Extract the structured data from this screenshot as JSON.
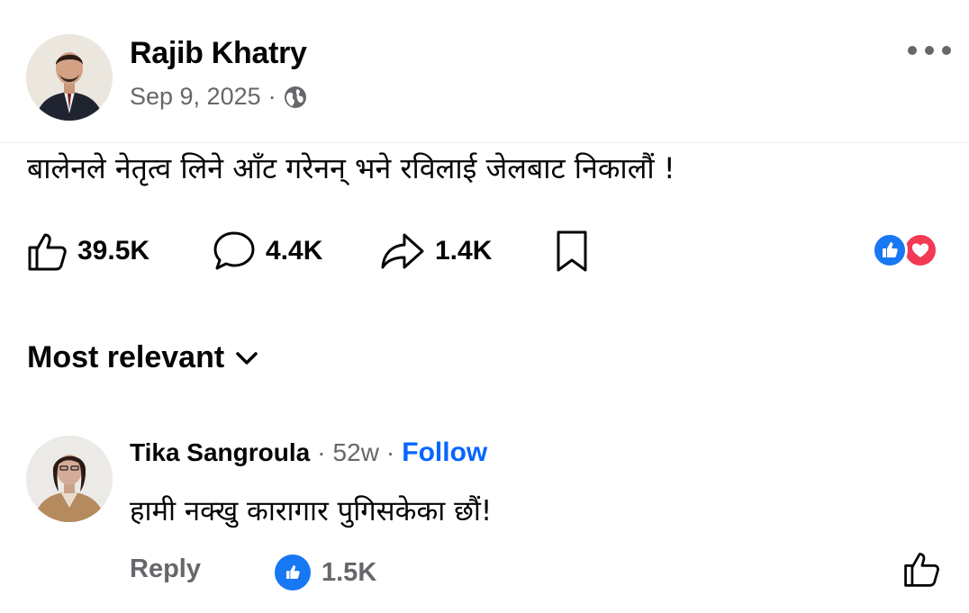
{
  "post": {
    "author": "Rajib Khatry",
    "date": "Sep 9, 2025",
    "separator": "·",
    "audience_icon": "globe-icon",
    "text": "बालेनले नेतृत्व लिने आँट गरेनन् भने रविलाई जेलबाट निकालौं !"
  },
  "actions": {
    "likes": "39.5K",
    "comments": "4.4K",
    "shares": "1.4K"
  },
  "reactions": [
    "like",
    "love"
  ],
  "sort": {
    "label": "Most relevant"
  },
  "comment": {
    "author": "Tika Sangroula",
    "separator": "·",
    "time": "52w",
    "follow": "Follow",
    "text": "हामी नक्खु कारागार पुगिसकेका छौं!",
    "reply": "Reply",
    "reaction_count": "1.5K"
  },
  "colors": {
    "accent": "#0866ff",
    "like_blue": "#1877f2",
    "love_red": "#f23a55",
    "secondary_text": "#65676b"
  }
}
